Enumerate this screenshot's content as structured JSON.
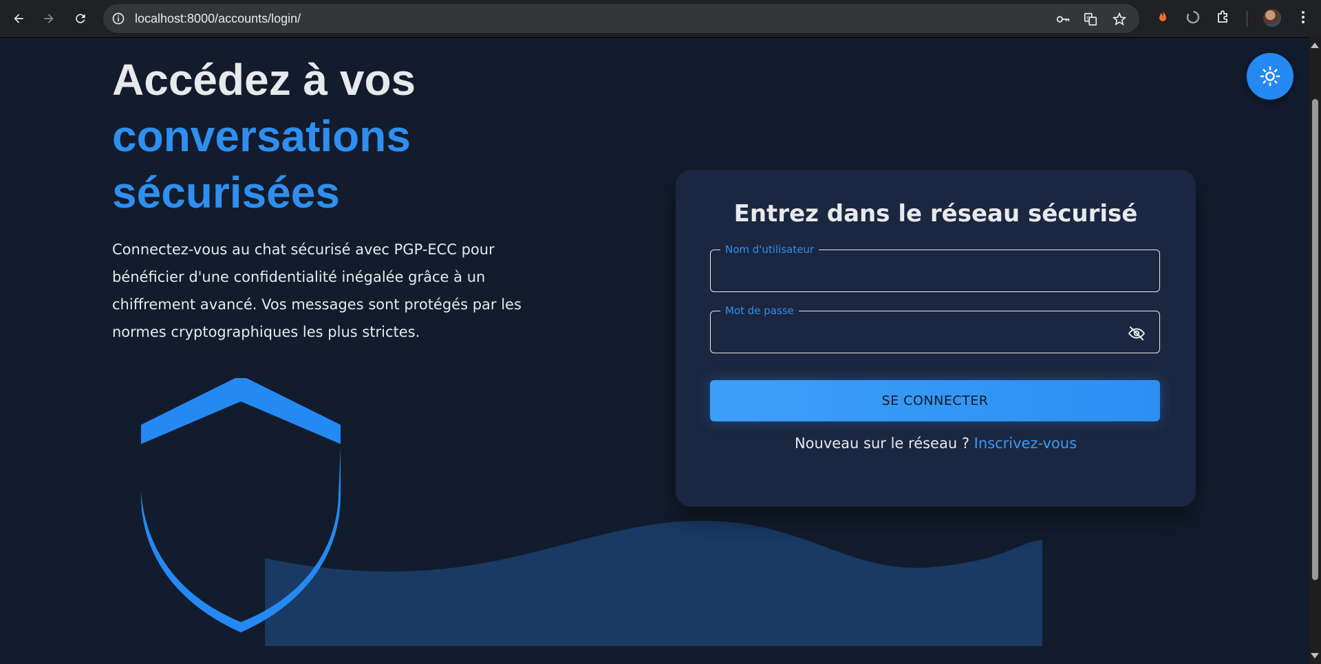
{
  "browser": {
    "url": "localhost:8000/accounts/login/"
  },
  "hero": {
    "title_line1": "Accédez à vos",
    "title_line2": "conversations",
    "title_line3": "sécurisées",
    "description": "Connectez-vous au chat sécurisé avec PGP-ECC pour bénéficier d'une confidentialité inégalée grâce à un chiffrement avancé. Vos messages sont protégés par les normes cryptographiques les plus strictes."
  },
  "login": {
    "title": "Entrez dans le réseau sécurisé",
    "username_label": "Nom d'utilisateur",
    "username_value": "",
    "password_label": "Mot de passe",
    "password_value": "",
    "submit_label": "SE CONNECTER",
    "signup_prompt": "Nouveau sur le réseau ? ",
    "signup_link": "Inscrivez-vous"
  },
  "icons": {
    "theme_toggle": "sun-icon",
    "password_visibility": "eye-off-icon"
  },
  "colors": {
    "background": "#121c2d",
    "card": "#1b2740",
    "accent": "#2e8ff0",
    "text": "#e7e9ed"
  }
}
